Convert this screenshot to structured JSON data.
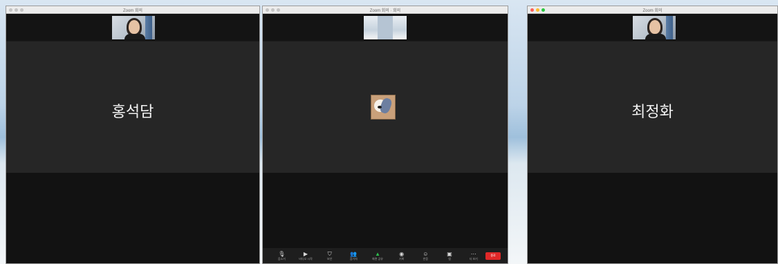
{
  "left_window": {
    "title": "Zoom 회의",
    "participant_name": "홍석담"
  },
  "center_window": {
    "title": "Zoom 회의 · 회의",
    "toolbar": {
      "items": [
        {
          "icon": "microphone-icon",
          "glyph": "🎙",
          "label": "음소거"
        },
        {
          "icon": "video-icon",
          "glyph": "▶",
          "label": "비디오 시작"
        },
        {
          "icon": "security-icon",
          "glyph": "⛉",
          "label": "보안"
        },
        {
          "icon": "participants-icon",
          "glyph": "👥",
          "label": "참가자"
        },
        {
          "icon": "share-screen-icon",
          "glyph": "▲",
          "label": "화면 공유"
        },
        {
          "icon": "record-icon",
          "glyph": "◉",
          "label": "기록"
        },
        {
          "icon": "reactions-icon",
          "glyph": "☺",
          "label": "반응"
        },
        {
          "icon": "apps-icon",
          "glyph": "▣",
          "label": "앱"
        },
        {
          "icon": "more-icon",
          "glyph": "⋯",
          "label": "더 보기"
        }
      ],
      "end_label": "종료"
    }
  },
  "right_window": {
    "title": "Zoom 회의",
    "participant_name": "최정화"
  },
  "colors": {
    "stage_bg": "#262626",
    "end_button": "#e02828",
    "active_icon": "#2dbd4e"
  }
}
